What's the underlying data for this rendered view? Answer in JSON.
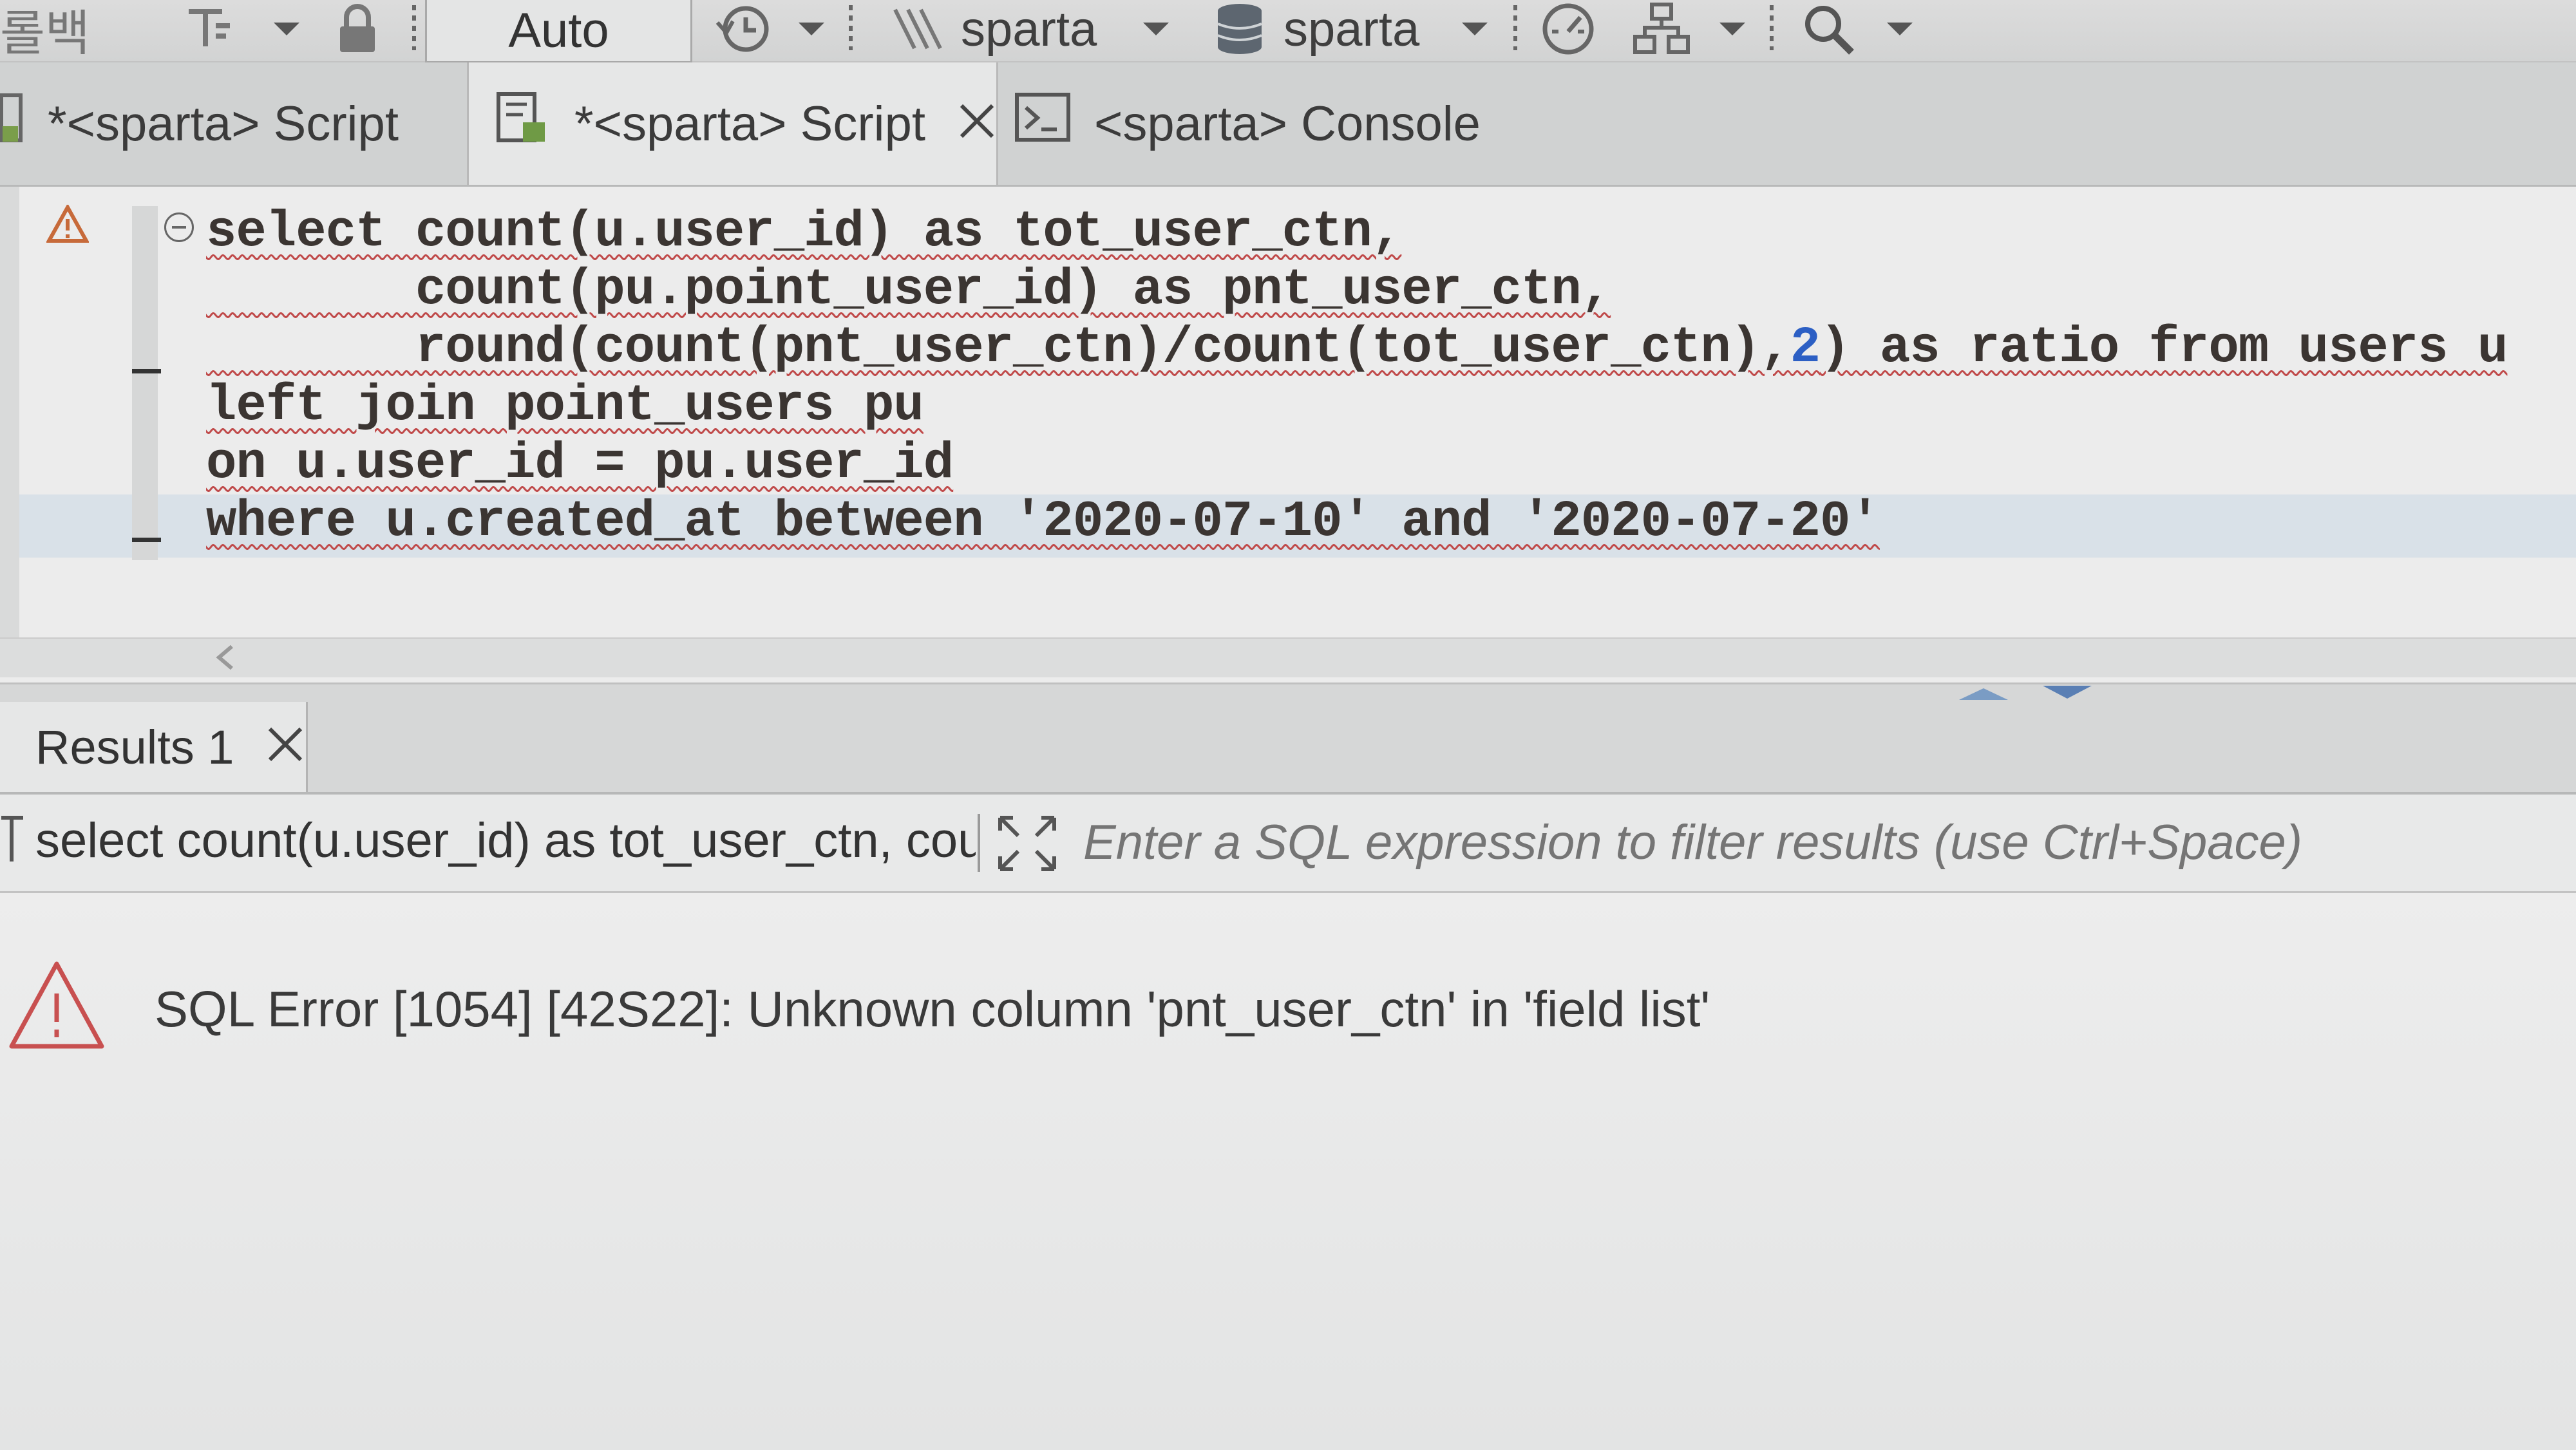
{
  "toolbar": {
    "rollback_label": "롤백",
    "transaction_mode": "Auto",
    "schema_label": "sparta",
    "database_label": "sparta",
    "icons": [
      "format-icon",
      "lock-icon",
      "history-icon",
      "schema-icon",
      "database-icon",
      "dashboard-icon",
      "hierarchy-icon",
      "search-icon"
    ]
  },
  "editor_tabs": [
    {
      "label": "*<sparta> Script",
      "active": false
    },
    {
      "label": "*<sparta> Script",
      "active": true
    },
    {
      "label": "<sparta> Console",
      "active": false
    }
  ],
  "editor": {
    "lines": [
      {
        "text": "select count(u.user_id) as tot_user_ctn,"
      },
      {
        "text": "       count(pu.point_user_id) as pnt_user_ctn,"
      },
      {
        "pre": "       round(count(pnt_user_ctn)/count(tot_user_ctn),",
        "num": "2",
        "post": ") as ratio from users u"
      },
      {
        "text": "left join point_users pu"
      },
      {
        "text": "on u.user_id = pu.user_id"
      },
      {
        "text": "where u.created_at between '2020-07-10' and '2020-07-20'"
      }
    ]
  },
  "results": {
    "tab_label": "Results 1",
    "query_preview": "select count(u.user_id) as tot_user_ctn, count(",
    "filter_placeholder": "Enter a SQL expression to filter results (use Ctrl+Space)",
    "error_message": "SQL Error [1054] [42S22]: Unknown column 'pnt_user_ctn' in 'field list'"
  }
}
